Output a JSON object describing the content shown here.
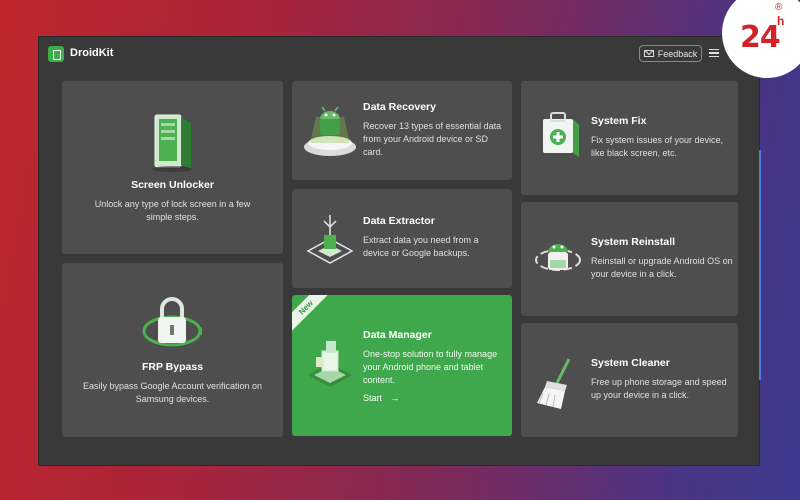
{
  "app": {
    "name": "DroidKit",
    "feedback_label": "Feedback"
  },
  "cards": {
    "screen_unlocker": {
      "title": "Screen Unlocker",
      "desc": "Unlock any type of lock screen in a few simple steps."
    },
    "frp_bypass": {
      "title": "FRP Bypass",
      "desc": "Easily bypass Google Account verification on Samsung devices."
    },
    "data_recovery": {
      "title": "Data Recovery",
      "desc": "Recover 13 types of essential data from your Android device or SD card."
    },
    "data_extractor": {
      "title": "Data Extractor",
      "desc": "Extract data you need from a device or Google backups."
    },
    "data_manager": {
      "title": "Data Manager",
      "desc": "One-stop solution to fully manage your Android phone and tablet content.",
      "badge": "New",
      "start_label": "Start"
    },
    "system_fix": {
      "title": "System Fix",
      "desc": "Fix system issues of your device, like black screen, etc."
    },
    "system_reinstall": {
      "title": "System Reinstall",
      "desc": "Reinstall or upgrade Android OS on your device in a click."
    },
    "system_cleaner": {
      "title": "System Cleaner",
      "desc": "Free up phone storage and speed up your device in a click."
    }
  },
  "watermark": {
    "text": "24",
    "sup": "h",
    "reg": "®"
  },
  "colors": {
    "accent": "#3fa84c",
    "card_bg": "#4e4e4e",
    "window_bg": "#393939",
    "watermark_red": "#d0232a"
  }
}
